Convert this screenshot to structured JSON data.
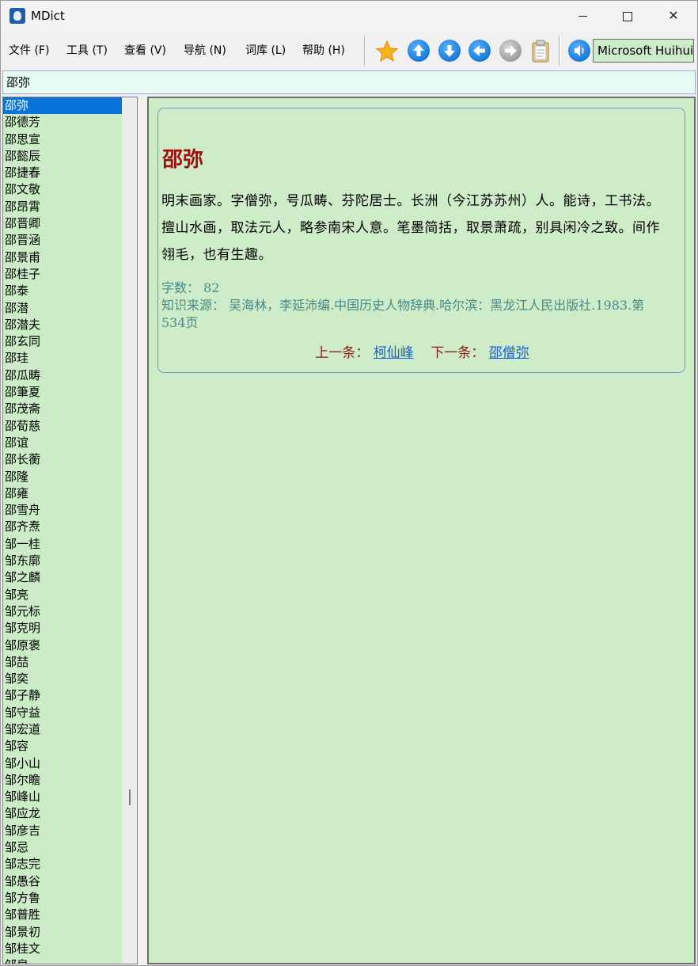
{
  "window": {
    "title": "MDict"
  },
  "menu": [
    "文件 (F)",
    "工具 (T)",
    "查看 (V)",
    "导航 (N)",
    "词库 (L)",
    "帮助 (H)"
  ],
  "toolbar": {
    "font": "Microsoft Huihui"
  },
  "search": {
    "value": "邵弥"
  },
  "word_list": [
    "邵弥",
    "邵德芳",
    "邵思宣",
    "邵懿辰",
    "邵捷春",
    "邵文敬",
    "邵昂霄",
    "邵晋卿",
    "邵晋涵",
    "邵景甫",
    "邵桂子",
    "邵泰",
    "邵潜",
    "邵潜夫",
    "邵玄同",
    "邵珪",
    "邵瓜畴",
    "邵筆夏",
    "邵茂斋",
    "邵荀慈",
    "邵谊",
    "邵长蘅",
    "邵隆",
    "邵雍",
    "邵雪舟",
    "邵齐焘",
    "邹一桂",
    "邹东廓",
    "邹之麟",
    "邹亮",
    "邹元标",
    "邹克明",
    "邹原褒",
    "邹喆",
    "邹奕",
    "邹子静",
    "邹守益",
    "邹宏道",
    "邹容",
    "邹小山",
    "邹尔瞻",
    "邹峰山",
    "邹应龙",
    "邹彦吉",
    "邹忌",
    "邹志完",
    "邹愚谷",
    "邹方鲁",
    "邹普胜",
    "邹景初",
    "邹桂文",
    "邹泉"
  ],
  "entry": {
    "headword": "邵弥",
    "definition": "明末画家。字僧弥，号瓜畴、芬陀居士。长洲（今江苏苏州）人。能诗，工书法。擅山水画，取法元人，略参南宋人意。笔墨简括，取景萧疏，别具闲冷之致。间作翎毛，也有生趣。",
    "word_count": "字数： 82",
    "source": "知识来源： 吴海林，李延沛编.中国历史人物辞典.哈尔滨：黑龙江人民出版社.1983.第534页",
    "prev_label": "上一条：",
    "prev_link": "柯仙峰",
    "next_label": "下一条：",
    "next_link": "邵僧弥"
  }
}
